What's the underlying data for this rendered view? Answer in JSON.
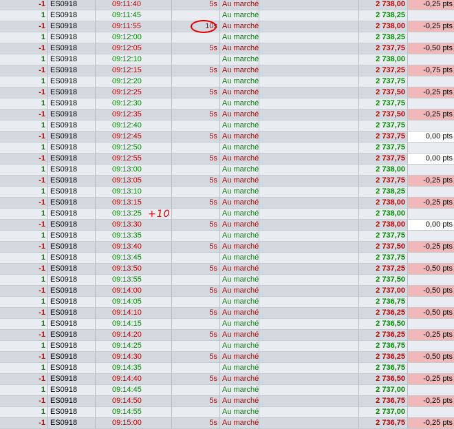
{
  "annotations": {
    "circle_target": "10s",
    "note": "+10"
  },
  "rows": [
    {
      "qty": "-1",
      "symbol": "ES0918",
      "time": "09:11:40",
      "dur": "5s",
      "type": "Au marché",
      "price": "2 738,00",
      "delta": "-0,25 pts",
      "side": "sell"
    },
    {
      "qty": "1",
      "symbol": "ES0918",
      "time": "09:11:45",
      "dur": "",
      "type": "Au marché",
      "price": "2 738,25",
      "delta": "",
      "side": "buy"
    },
    {
      "qty": "-1",
      "symbol": "ES0918",
      "time": "09:11:55",
      "dur": "10s",
      "type": "Au marché",
      "price": "2 738,00",
      "delta": "-0,25 pts",
      "side": "sell"
    },
    {
      "qty": "1",
      "symbol": "ES0918",
      "time": "09:12:00",
      "dur": "",
      "type": "Au marché",
      "price": "2 738,25",
      "delta": "",
      "side": "buy"
    },
    {
      "qty": "-1",
      "symbol": "ES0918",
      "time": "09:12:05",
      "dur": "5s",
      "type": "Au marché",
      "price": "2 737,75",
      "delta": "-0,50 pts",
      "side": "sell"
    },
    {
      "qty": "1",
      "symbol": "ES0918",
      "time": "09:12:10",
      "dur": "",
      "type": "Au marché",
      "price": "2 738,00",
      "delta": "",
      "side": "buy"
    },
    {
      "qty": "-1",
      "symbol": "ES0918",
      "time": "09:12:15",
      "dur": "5s",
      "type": "Au marché",
      "price": "2 737,25",
      "delta": "-0,75 pts",
      "side": "sell"
    },
    {
      "qty": "1",
      "symbol": "ES0918",
      "time": "09:12:20",
      "dur": "",
      "type": "Au marché",
      "price": "2 737,75",
      "delta": "",
      "side": "buy"
    },
    {
      "qty": "-1",
      "symbol": "ES0918",
      "time": "09:12:25",
      "dur": "5s",
      "type": "Au marché",
      "price": "2 737,50",
      "delta": "-0,25 pts",
      "side": "sell"
    },
    {
      "qty": "1",
      "symbol": "ES0918",
      "time": "09:12:30",
      "dur": "",
      "type": "Au marché",
      "price": "2 737,75",
      "delta": "",
      "side": "buy"
    },
    {
      "qty": "-1",
      "symbol": "ES0918",
      "time": "09:12:35",
      "dur": "5s",
      "type": "Au marché",
      "price": "2 737,50",
      "delta": "-0,25 pts",
      "side": "sell"
    },
    {
      "qty": "1",
      "symbol": "ES0918",
      "time": "09:12:40",
      "dur": "",
      "type": "Au marché",
      "price": "2 737,75",
      "delta": "",
      "side": "buy"
    },
    {
      "qty": "-1",
      "symbol": "ES0918",
      "time": "09:12:45",
      "dur": "5s",
      "type": "Au marché",
      "price": "2 737,75",
      "delta": "0,00 pts",
      "side": "sell"
    },
    {
      "qty": "1",
      "symbol": "ES0918",
      "time": "09:12:50",
      "dur": "",
      "type": "Au marché",
      "price": "2 737,75",
      "delta": "",
      "side": "buy"
    },
    {
      "qty": "-1",
      "symbol": "ES0918",
      "time": "09:12:55",
      "dur": "5s",
      "type": "Au marché",
      "price": "2 737,75",
      "delta": "0,00 pts",
      "side": "sell"
    },
    {
      "qty": "1",
      "symbol": "ES0918",
      "time": "09:13:00",
      "dur": "",
      "type": "Au marché",
      "price": "2 738,00",
      "delta": "",
      "side": "buy"
    },
    {
      "qty": "-1",
      "symbol": "ES0918",
      "time": "09:13:05",
      "dur": "5s",
      "type": "Au marché",
      "price": "2 737,75",
      "delta": "-0,25 pts",
      "side": "sell"
    },
    {
      "qty": "1",
      "symbol": "ES0918",
      "time": "09:13:10",
      "dur": "",
      "type": "Au marché",
      "price": "2 738,25",
      "delta": "",
      "side": "buy"
    },
    {
      "qty": "-1",
      "symbol": "ES0918",
      "time": "09:13:15",
      "dur": "5s",
      "type": "Au marché",
      "price": "2 738,00",
      "delta": "-0,25 pts",
      "side": "sell"
    },
    {
      "qty": "1",
      "symbol": "ES0918",
      "time": "09:13:25",
      "dur": "",
      "type": "Au marché",
      "price": "2 738,00",
      "delta": "",
      "side": "buy"
    },
    {
      "qty": "-1",
      "symbol": "ES0918",
      "time": "09:13:30",
      "dur": "5s",
      "type": "Au marché",
      "price": "2 738,00",
      "delta": "0,00 pts",
      "side": "sell"
    },
    {
      "qty": "1",
      "symbol": "ES0918",
      "time": "09:13:35",
      "dur": "",
      "type": "Au marché",
      "price": "2 737,75",
      "delta": "",
      "side": "buy"
    },
    {
      "qty": "-1",
      "symbol": "ES0918",
      "time": "09:13:40",
      "dur": "5s",
      "type": "Au marché",
      "price": "2 737,50",
      "delta": "-0,25 pts",
      "side": "sell"
    },
    {
      "qty": "1",
      "symbol": "ES0918",
      "time": "09:13:45",
      "dur": "",
      "type": "Au marché",
      "price": "2 737,75",
      "delta": "",
      "side": "buy"
    },
    {
      "qty": "-1",
      "symbol": "ES0918",
      "time": "09:13:50",
      "dur": "5s",
      "type": "Au marché",
      "price": "2 737,25",
      "delta": "-0,50 pts",
      "side": "sell"
    },
    {
      "qty": "1",
      "symbol": "ES0918",
      "time": "09:13:55",
      "dur": "",
      "type": "Au marché",
      "price": "2 737,50",
      "delta": "",
      "side": "buy"
    },
    {
      "qty": "-1",
      "symbol": "ES0918",
      "time": "09:14:00",
      "dur": "5s",
      "type": "Au marché",
      "price": "2 737,00",
      "delta": "-0,50 pts",
      "side": "sell"
    },
    {
      "qty": "1",
      "symbol": "ES0918",
      "time": "09:14:05",
      "dur": "",
      "type": "Au marché",
      "price": "2 736,75",
      "delta": "",
      "side": "buy"
    },
    {
      "qty": "-1",
      "symbol": "ES0918",
      "time": "09:14:10",
      "dur": "5s",
      "type": "Au marché",
      "price": "2 736,25",
      "delta": "-0,50 pts",
      "side": "sell"
    },
    {
      "qty": "1",
      "symbol": "ES0918",
      "time": "09:14:15",
      "dur": "",
      "type": "Au marché",
      "price": "2 736,50",
      "delta": "",
      "side": "buy"
    },
    {
      "qty": "-1",
      "symbol": "ES0918",
      "time": "09:14:20",
      "dur": "5s",
      "type": "Au marché",
      "price": "2 736,25",
      "delta": "-0,25 pts",
      "side": "sell"
    },
    {
      "qty": "1",
      "symbol": "ES0918",
      "time": "09:14:25",
      "dur": "",
      "type": "Au marché",
      "price": "2 736,75",
      "delta": "",
      "side": "buy"
    },
    {
      "qty": "-1",
      "symbol": "ES0918",
      "time": "09:14:30",
      "dur": "5s",
      "type": "Au marché",
      "price": "2 736,25",
      "delta": "-0,50 pts",
      "side": "sell"
    },
    {
      "qty": "1",
      "symbol": "ES0918",
      "time": "09:14:35",
      "dur": "",
      "type": "Au marché",
      "price": "2 736,75",
      "delta": "",
      "side": "buy"
    },
    {
      "qty": "-1",
      "symbol": "ES0918",
      "time": "09:14:40",
      "dur": "5s",
      "type": "Au marché",
      "price": "2 736,50",
      "delta": "-0,25 pts",
      "side": "sell"
    },
    {
      "qty": "1",
      "symbol": "ES0918",
      "time": "09:14:45",
      "dur": "",
      "type": "Au marché",
      "price": "2 737,00",
      "delta": "",
      "side": "buy"
    },
    {
      "qty": "-1",
      "symbol": "ES0918",
      "time": "09:14:50",
      "dur": "5s",
      "type": "Au marché",
      "price": "2 736,75",
      "delta": "-0,25 pts",
      "side": "sell"
    },
    {
      "qty": "1",
      "symbol": "ES0918",
      "time": "09:14:55",
      "dur": "",
      "type": "Au marché",
      "price": "2 737,00",
      "delta": "",
      "side": "buy"
    },
    {
      "qty": "-1",
      "symbol": "ES0918",
      "time": "09:15:00",
      "dur": "5s",
      "type": "Au marché",
      "price": "2 736,75",
      "delta": "-0,25 pts",
      "side": "sell"
    }
  ]
}
